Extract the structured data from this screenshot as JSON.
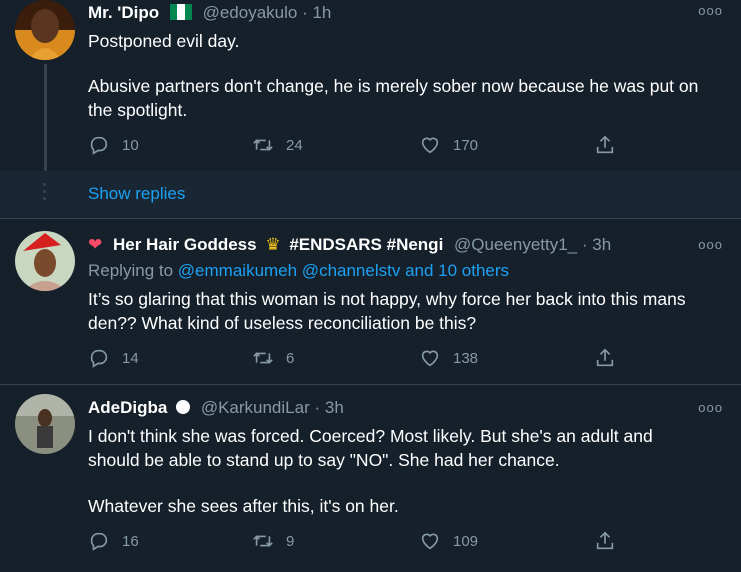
{
  "tweets": [
    {
      "name": "Mr. 'Dipo",
      "handle": "@edoyakulo",
      "time": "· 1h",
      "more": "ooo",
      "text1": "Postponed evil day.",
      "text2": "Abusive partners don't change, he is merely sober now because he was put on the spotlight.",
      "replies": "10",
      "retweets": "24",
      "likes": "170"
    },
    {
      "name": "Her Hair Goddess",
      "tags": "#ENDSARS #Nengi",
      "handle": "@Queenyetty1_",
      "time": "· 3h",
      "more": "ooo",
      "replying_prefix": "Replying to",
      "replying_users": "@emmaikumeh @channelstv and 10 others",
      "text1": "It’s so glaring that this woman is not happy, why force her back into this mans den?? What kind of useless reconciliation be this?",
      "replies": "14",
      "retweets": "6",
      "likes": "138"
    },
    {
      "name": "AdeDigba",
      "handle": "@KarkundiLar",
      "time": "· 3h",
      "more": "ooo",
      "text1": "I don't think she was forced. Coerced? Most likely. But she's an adult and should be able to stand up to say \"NO\". She had her chance.",
      "text2": "Whatever she sees after this, it's on her.",
      "replies": "16",
      "retweets": "9",
      "likes": "109"
    }
  ],
  "show_replies": "Show replies",
  "colors": {
    "background": "#15202b",
    "accent": "#1da1f2",
    "muted": "#8899a6",
    "border": "#38444d"
  }
}
